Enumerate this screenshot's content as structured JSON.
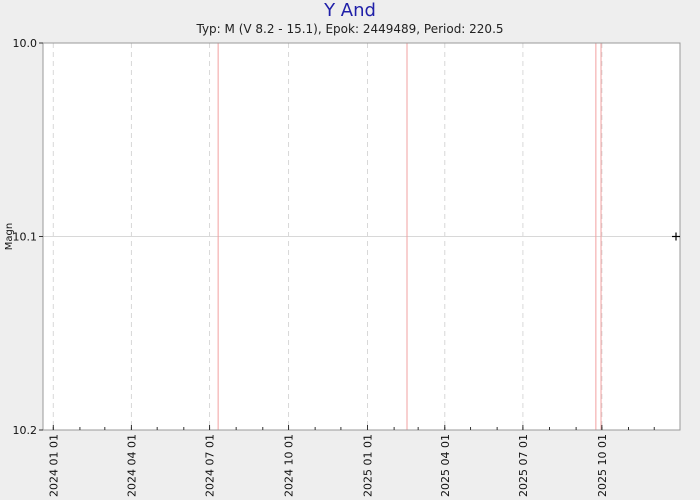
{
  "chart_data": {
    "type": "scatter",
    "title": "Y And",
    "subtitle": "Typ: M (V 8.2 - 15.1), Epok: 2449489, Period: 220.5",
    "xlabel": "",
    "ylabel": "Magn",
    "y_inverted": true,
    "ylim": [
      10.0,
      10.2
    ],
    "y_ticks": [
      "10.0",
      "10.1",
      "10.2"
    ],
    "xlim": [
      "2023-12-20",
      "2025-12-31"
    ],
    "x_ticks": [
      {
        "date": "2024-01-01",
        "label": "2024 01 01"
      },
      {
        "date": "2024-04-01",
        "label": "2024 04 01"
      },
      {
        "date": "2024-07-01",
        "label": "2024 07 01"
      },
      {
        "date": "2024-10-01",
        "label": "2024 10 01"
      },
      {
        "date": "2025-01-01",
        "label": "2025 01 01"
      },
      {
        "date": "2025-04-01",
        "label": "2025 04 01"
      },
      {
        "date": "2025-07-01",
        "label": "2025 07 01"
      },
      {
        "date": "2025-10-01",
        "label": "2025 10 01"
      }
    ],
    "max_lines": [
      "2024-07-11",
      "2025-02-16",
      "2025-09-24",
      "2025-09-30"
    ],
    "max_line_color": "#f2a0a0",
    "series": [
      {
        "marker": "+",
        "color": "#000000",
        "points": [
          {
            "x": "2025-12-31",
            "y": 10.1
          }
        ]
      }
    ],
    "grid": true
  }
}
